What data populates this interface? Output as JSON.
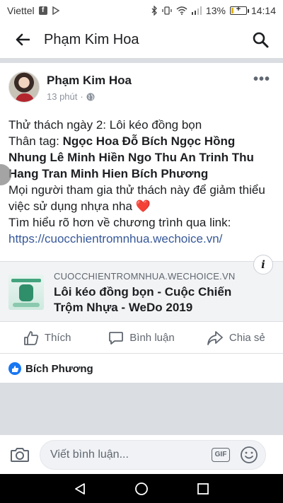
{
  "status_bar": {
    "carrier": "Viettel",
    "battery_percent": "13%",
    "battery_level": 0.13,
    "time": "14:14"
  },
  "header": {
    "title": "Phạm Kim Hoa"
  },
  "post": {
    "author": "Phạm Kim Hoa",
    "time": "13 phút",
    "separator": "·",
    "line1": "Thử thách ngày 2: Lôi kéo đồng bọn",
    "tag_prefix": "Thân tag: ",
    "tags": "Ngọc Hoa Đỗ Bích Ngọc Hồng Nhung Lê Minh Hiền Ngo Thu An Trinh Thu Hang Tran Minh Hien Bích Phương",
    "line3": "Mọi người tham gia thử thách này để giảm thiểu việc sử dụng nhựa nha ",
    "heart": "❤️",
    "line4": "Tìm hiểu rõ hơn về chương trình qua link:",
    "link": "https://cuocchientromnhua.wechoice.vn/"
  },
  "link_preview": {
    "domain": "CUOCCHIENTROMNHUA.WECHOICE.VN",
    "title": "Lôi kéo đồng bọn - Cuộc Chiến Trộm Nhựa - WeDo 2019",
    "info_label": "i"
  },
  "actions": {
    "like": "Thích",
    "comment": "Bình luận",
    "share": "Chia sẻ"
  },
  "reactions": {
    "names": "Bích Phương"
  },
  "comment_bar": {
    "placeholder": "Viết bình luận...",
    "gif_label": "GIF"
  },
  "icons": {
    "back": "arrow-left-icon",
    "search": "search-icon",
    "more": "more-horizontal-icon",
    "privacy": "globe-icon",
    "like": "thumbs-up-icon",
    "comment": "speech-bubble-icon",
    "share": "share-arrow-icon",
    "camera": "camera-icon",
    "emoji": "smiley-icon"
  },
  "colors": {
    "link": "#365899",
    "like_blue": "#1877f2",
    "heart": "#e02424"
  }
}
